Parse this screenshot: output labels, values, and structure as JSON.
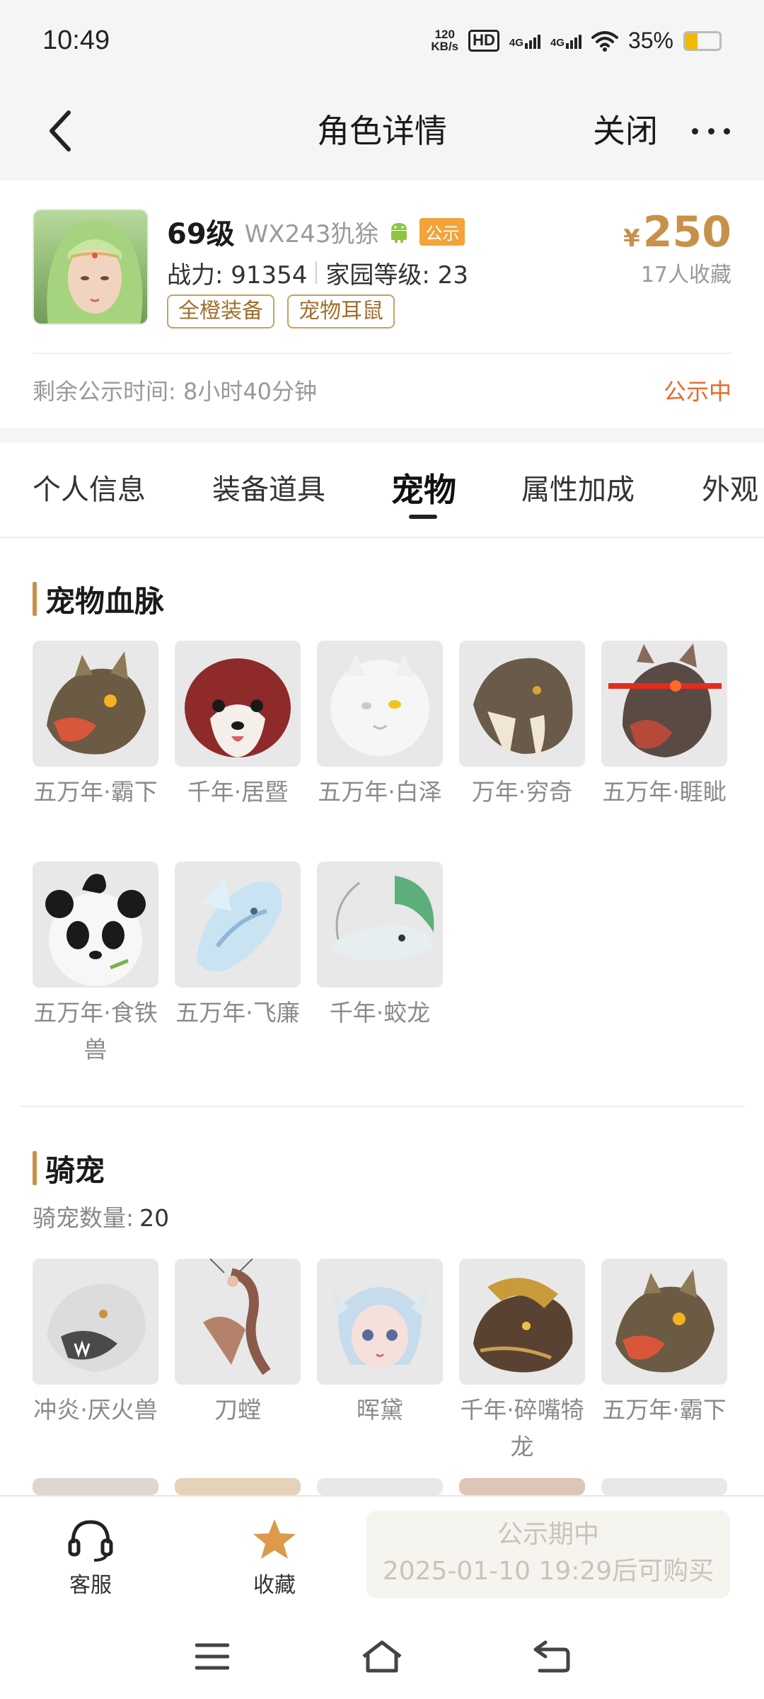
{
  "status_bar": {
    "time": "10:49",
    "net_speed_value": "120",
    "net_speed_unit": "KB/s",
    "hd_label": "HD",
    "net1": "4G",
    "net2": "4G",
    "battery_pct": "35%",
    "battery_level": 0.35,
    "battery_color": "#f5b800"
  },
  "header": {
    "title": "角色详情",
    "close_label": "关闭",
    "back_icon": "chevron-left-icon",
    "more_icon": "more-dots-icon"
  },
  "role": {
    "level": "69级",
    "name": "WX243犰狳",
    "platform_icon": "android-icon",
    "badge": "公示",
    "power_label": "战力: 91354",
    "home_level_label": "家园等级: 23",
    "tags": [
      "全橙装备",
      "宠物耳鼠"
    ],
    "price_currency": "¥",
    "price": "250",
    "fav_count": "17人收藏",
    "remain_time": "剩余公示时间: 8小时40分钟",
    "status": "公示中",
    "price_color": "#c8914a",
    "status_color": "#e8692a"
  },
  "tabs": [
    {
      "label": "个人信息",
      "active": false
    },
    {
      "label": "装备道具",
      "active": false
    },
    {
      "label": "宠物",
      "active": true
    },
    {
      "label": "属性加成",
      "active": false
    },
    {
      "label": "外观",
      "active": false
    }
  ],
  "pet_bloodline": {
    "title": "宠物血脉",
    "items": [
      {
        "name": "五万年·霸下"
      },
      {
        "name": "千年·居暨"
      },
      {
        "name": "五万年·白泽"
      },
      {
        "name": "万年·穷奇"
      },
      {
        "name": "五万年·睚眦"
      },
      {
        "name": "五万年·食铁兽"
      },
      {
        "name": "五万年·飞廉"
      },
      {
        "name": "千年·蛟龙"
      }
    ]
  },
  "mounts": {
    "title": "骑宠",
    "count_label": "骑宠数量:",
    "count": "20",
    "items": [
      {
        "name": "冲炎·厌火兽"
      },
      {
        "name": "刀螳"
      },
      {
        "name": "晖黛"
      },
      {
        "name": "千年·碎嘴犄龙"
      },
      {
        "name": "五万年·霸下"
      }
    ]
  },
  "bottom": {
    "service_label": "客服",
    "fav_label": "收藏",
    "buy_line1": "公示期中",
    "buy_line2": "2025-01-10 19:29后可购买"
  }
}
